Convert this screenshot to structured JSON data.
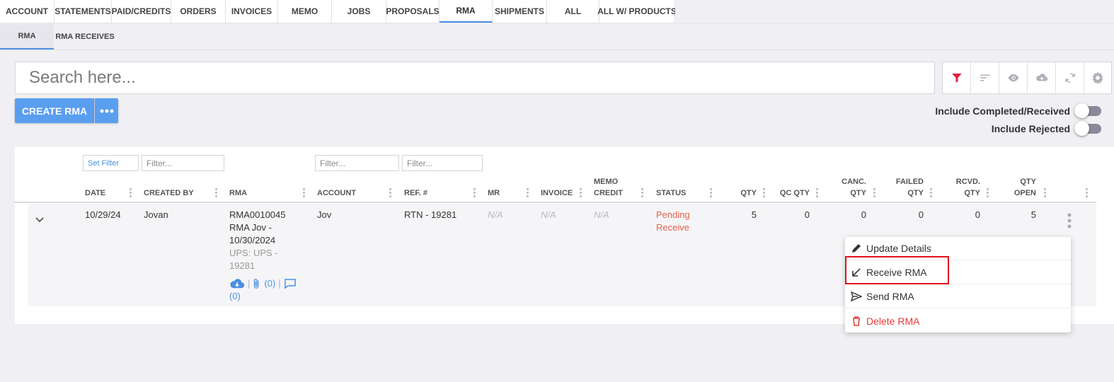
{
  "top_tabs": [
    "ACCOUNT",
    "STATEMENTS",
    "PAID/CREDITS",
    "ORDERS",
    "INVOICES",
    "MEMO",
    "JOBS",
    "PROPOSALS",
    "RMA",
    "SHIPMENTS",
    "ALL",
    "ALL W/ PRODUCTS"
  ],
  "top_tab_active": "RMA",
  "sub_tabs": [
    "RMA",
    "RMA RECEIVES"
  ],
  "search": {
    "placeholder": "Search here..."
  },
  "toolbar_icons": [
    "filter-icon",
    "sort-icon",
    "eye-icon",
    "cloud-download-icon",
    "refresh-icon",
    "gear-icon"
  ],
  "create_button": "CREATE RMA",
  "toggles": {
    "completed_label": "Include Completed/Received",
    "rejected_label": "Include Rejected"
  },
  "filters": {
    "set_filter": "Set Filter",
    "placeholder": "Filter..."
  },
  "columns": {
    "date": "DATE",
    "created_by": "CREATED BY",
    "rma": "RMA",
    "account": "ACCOUNT",
    "ref": "REF. #",
    "mr": "MR",
    "invoice": "INVOICE",
    "memo_credit_1": "MEMO",
    "memo_credit_2": "CREDIT",
    "status": "STATUS",
    "qty": "QTY",
    "qc_qty": "QC QTY",
    "canc_1": "CANC.",
    "canc_2": "QTY",
    "failed_1": "FAILED",
    "failed_2": "QTY",
    "rcvd_1": "RCVD.",
    "rcvd_2": "QTY",
    "open_1": "QTY",
    "open_2": "OPEN"
  },
  "row": {
    "date": "10/29/24",
    "created_by": "Jovan",
    "rma_line1": "RMA0010045",
    "rma_line2": "RMA Jov -",
    "rma_line3": "10/30/2024",
    "rma_line4": "UPS: UPS -",
    "rma_line5": "19281",
    "attachments": "(0)",
    "comments": "(0)",
    "account": "Jov",
    "ref": "RTN - 19281",
    "mr": "N/A",
    "invoice": "N/A",
    "memo_credit": "N/A",
    "status_line1": "Pending",
    "status_line2": "Receive",
    "qty": "5",
    "qc_qty": "0",
    "canc_qty": "0",
    "failed_qty": "0",
    "rcvd_qty": "0",
    "qty_open": "5"
  },
  "menu": {
    "update_details": "Update Details",
    "receive_rma": "Receive RMA",
    "send_rma": "Send RMA",
    "delete_rma": "Delete RMA"
  },
  "colors": {
    "accent": "#4a90e2",
    "primary_button": "#5a9ef0",
    "status": "#e8604c",
    "danger": "#e53935",
    "highlight": "#e0141e",
    "filter_icon": "#e0203c"
  }
}
